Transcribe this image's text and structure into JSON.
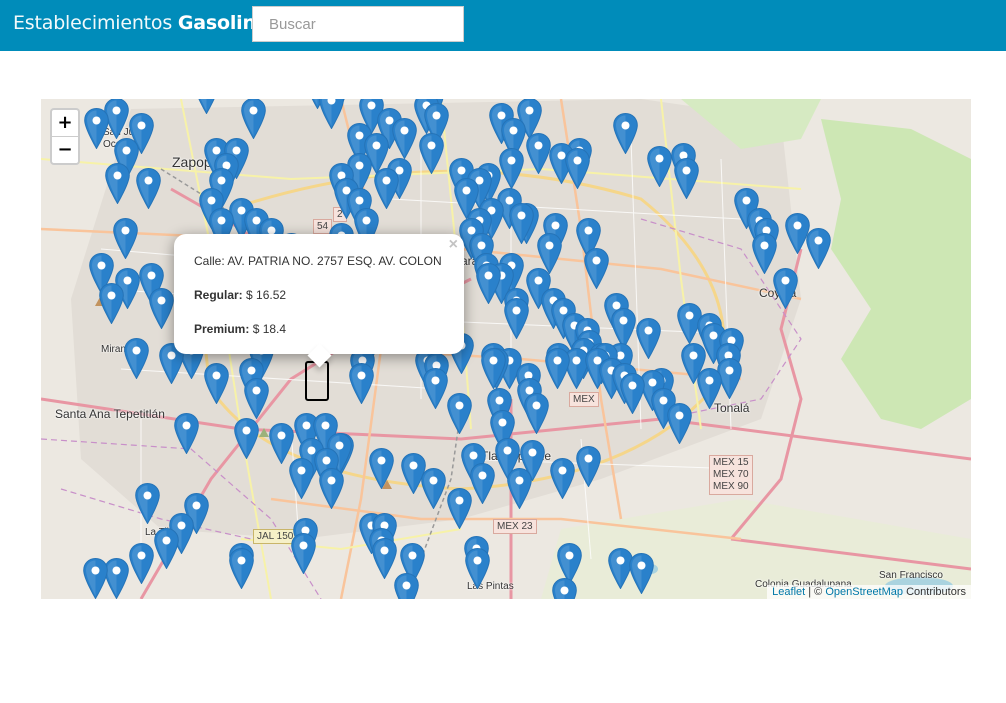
{
  "navbar": {
    "brand_light": "Establecimientos",
    "brand_bold": "Gasolina",
    "search_placeholder": "Buscar"
  },
  "map": {
    "zoom_in": "+",
    "zoom_out": "−",
    "attribution": {
      "leaflet": "Leaflet",
      "separator": "| ©",
      "osm": "OpenStreetMap",
      "contributors": "Contributors"
    },
    "place_labels": {
      "zapopan": "Zapopan",
      "san_juan": "San Juan",
      "ocotan": "Ocotán",
      "miramar": "Miramar",
      "santa_ana": "Santa Ana Tepetitlán",
      "la_tijera": "La Tijera",
      "tlaquepaque": "Tlaquepaque",
      "las_pintas": "Las Pintas",
      "tonala": "Tonalá",
      "coyula": "Coyula",
      "colonia_guadalupana": "Colonia Guadalupana",
      "san_francisco": "San Francisco",
      "guadalajara_fragment": "ara"
    },
    "road_shields": {
      "jal150": "JAL 150",
      "mex23": "MEX 23",
      "mex_fragment": "MEX",
      "mex_stack": [
        "MEX 15",
        "MEX 70",
        "MEX 90"
      ],
      "mex54": "54",
      "mex2": "2"
    }
  },
  "popup": {
    "close": "×",
    "address_label": "Calle:",
    "address_value": "AV. PATRIA NO. 2757 ESQ. AV. COLON",
    "regular_label": "Regular:",
    "regular_value": "$ 16.52",
    "premium_label": "Premium:",
    "premium_value": "$ 18.4"
  },
  "colors": {
    "navbar": "#008cba",
    "marker": "#2a81cb",
    "marker_dark": "#2573b7"
  }
}
